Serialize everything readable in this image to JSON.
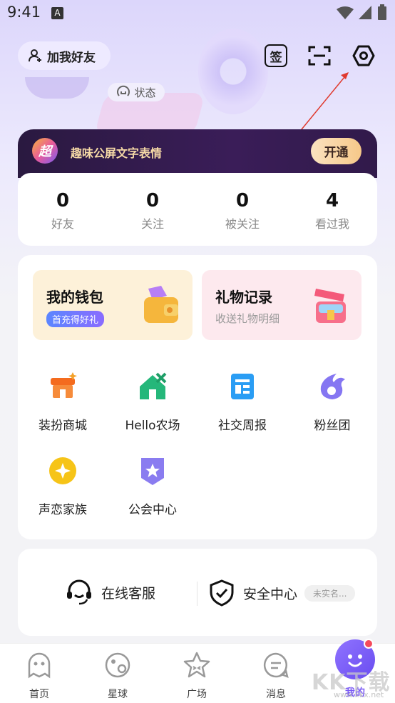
{
  "status_bar": {
    "time": "9:41",
    "notification_icon": "A"
  },
  "header": {
    "add_friend_label": "加我好友",
    "checkin_icon_text": "签",
    "status_label": "状态"
  },
  "vip_banner": {
    "badge": "超",
    "text": "趣味公屏文字表情",
    "button_label": "开通"
  },
  "stats": [
    {
      "value": "0",
      "label": "好友"
    },
    {
      "value": "0",
      "label": "关注"
    },
    {
      "value": "0",
      "label": "被关注"
    },
    {
      "value": "4",
      "label": "看过我"
    }
  ],
  "cards": {
    "wallet": {
      "title": "我的钱包",
      "tag": "首充得好礼"
    },
    "gifts": {
      "title": "礼物记录",
      "subtitle": "收送礼物明细"
    }
  },
  "grid": [
    {
      "label": "装扮商城",
      "icon": "shop-icon"
    },
    {
      "label": "Hello农场",
      "icon": "farm-icon"
    },
    {
      "label": "社交周报",
      "icon": "report-icon"
    },
    {
      "label": "粉丝团",
      "icon": "fan-club-icon"
    },
    {
      "label": "声恋家族",
      "icon": "family-icon"
    },
    {
      "label": "公会中心",
      "icon": "guild-icon"
    }
  ],
  "services": {
    "customer_service": "在线客服",
    "security_center": "安全中心",
    "verify_status": "未实名..."
  },
  "tabbar": [
    {
      "label": "首页"
    },
    {
      "label": "星球"
    },
    {
      "label": "广场"
    },
    {
      "label": "消息"
    },
    {
      "label": "我的"
    }
  ],
  "watermark": {
    "main": "KK下载",
    "sub": "www.kkx.net"
  },
  "colors": {
    "accent": "#7c5cf5",
    "vip_gold": "#f5d9a6",
    "badge_red": "#f54a5c"
  }
}
